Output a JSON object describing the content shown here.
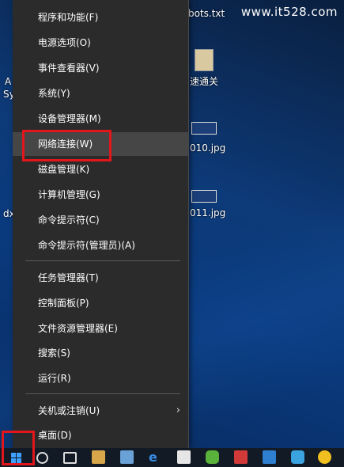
{
  "watermark": "www.it528.com",
  "desktop": {
    "file_robots": "bots.txt",
    "shortcut_label": "速通关",
    "image1": "010.jpg",
    "image2": "011.jpg",
    "left_text_1": "A",
    "left_text_2": "Sy",
    "left_text_3": "dx"
  },
  "menu": {
    "items": [
      {
        "label": "程序和功能(F)"
      },
      {
        "label": "电源选项(O)"
      },
      {
        "label": "事件查看器(V)"
      },
      {
        "label": "系统(Y)"
      },
      {
        "label": "设备管理器(M)"
      },
      {
        "label": "网络连接(W)"
      },
      {
        "label": "磁盘管理(K)"
      },
      {
        "label": "计算机管理(G)"
      },
      {
        "label": "命令提示符(C)"
      },
      {
        "label": "命令提示符(管理员)(A)"
      },
      {
        "label": "任务管理器(T)"
      },
      {
        "label": "控制面板(P)"
      },
      {
        "label": "文件资源管理器(E)"
      },
      {
        "label": "搜索(S)"
      },
      {
        "label": "运行(R)"
      },
      {
        "label": "关机或注销(U)"
      },
      {
        "label": "桌面(D)"
      }
    ],
    "submenu_chevron": "›"
  },
  "colors": {
    "menu_bg": "#2b2b2b",
    "highlight": "#e3161b",
    "taskbar": "#121a26"
  }
}
